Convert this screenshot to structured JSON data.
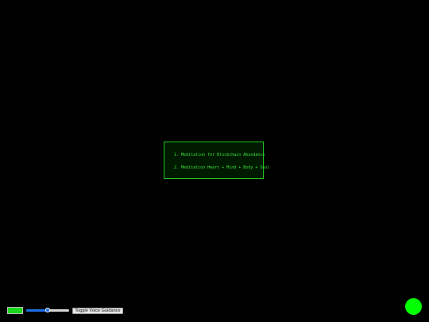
{
  "menu": {
    "items": [
      {
        "label": "1. Meditation for Blockchain Abundance"
      },
      {
        "label": "2. Meditation Heart + Mind + Body + Soul"
      }
    ]
  },
  "controls": {
    "color_swatch": {
      "icon": "color-swatch",
      "color": "#1bd61b"
    },
    "volume": {
      "value": 0.5
    },
    "voice_button_label": "Toggle Voice Guidance"
  },
  "status_indicator": {
    "color": "#00ff00"
  }
}
